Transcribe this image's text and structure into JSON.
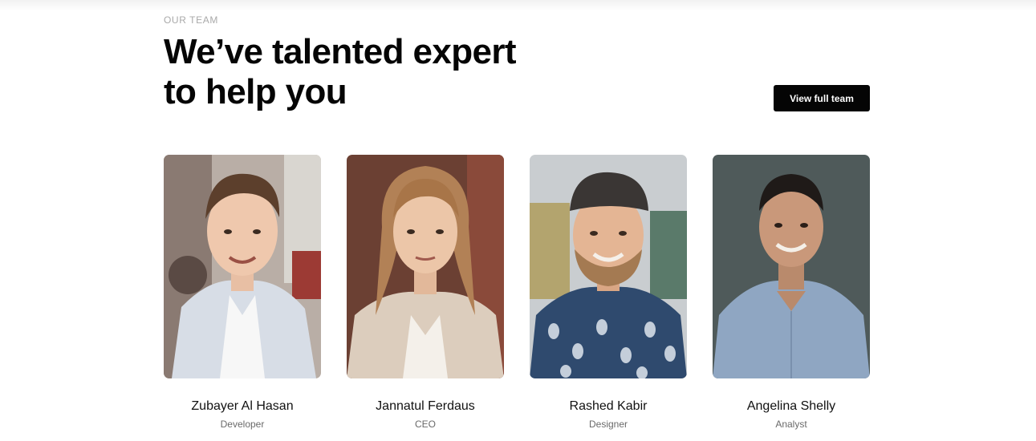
{
  "section": {
    "eyebrow": "OUR TEAM",
    "headline_line1": "We’ve talented expert",
    "headline_line2": "to help you",
    "cta_label": "View full team"
  },
  "team": [
    {
      "name": "Zubayer Al Hasan",
      "role": "Developer"
    },
    {
      "name": "Jannatul Ferdaus",
      "role": "CEO"
    },
    {
      "name": "Rashed Kabir",
      "role": "Designer"
    },
    {
      "name": "Angelina Shelly",
      "role": "Analyst"
    }
  ],
  "colors": {
    "accent": "#050505",
    "muted": "#a9a9a9",
    "role_text": "#6a6a6a"
  }
}
